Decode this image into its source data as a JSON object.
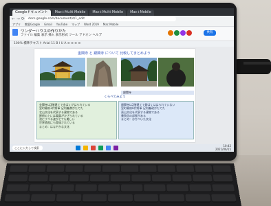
{
  "browser": {
    "tabs": [
      {
        "label": "Googleドキュメント",
        "active": true
      },
      {
        "label": "Mac+Multi-Mobile"
      },
      {
        "label": "Mac+Multi-Mobile"
      },
      {
        "label": "Mac+Mobile"
      }
    ],
    "url": "docs.google.com/document/d/1_edit",
    "bookmarks": [
      "アプリ",
      "教室Google",
      "Gmail",
      "YouTube",
      "マップ",
      "Word 2019",
      "Mac Mobile"
    ]
  },
  "document": {
    "title": "ワンダーハウスの作りかた",
    "menus": "ファイル 編集 表示 挿入 表示形式 ツール アドオン ヘルプ",
    "share_label": "共有",
    "toolbar_text": "100%  標準テキスト  Arial  11  B I U A  ≡ ≡ ≡ ≡",
    "heading": "金閣寺 と 銀閣寺 について 比較してまとめよう",
    "caption_right": "銀閣寺",
    "mid_label": "くらべてみよう",
    "green_box_lines": [
      "金閣寺は3階建てで金ぱくがはられている",
      "室町幕府3代将軍 足利義満がたてた",
      "北山文化を代表する建物である",
      "屋根の上には鳳凰がかざられている",
      "池にうつる姿がとても美しい",
      "世界遺産にも登録されている",
      "まとめ：はなやかな文化"
    ],
    "blue_box_lines": [
      "銀閣寺は2階建てで銀ぱくははられていない",
      "室町幕府8代将軍 足利義政がたてた",
      "東山文化を代表する建物である",
      "書院造の部屋がある",
      "まとめ：おちついた文化"
    ]
  },
  "taskbar": {
    "search_placeholder": "ここに入力して検索",
    "time": "10:42",
    "date": "2021/06/15"
  },
  "colors": {
    "browser_chrome": "#2e3135",
    "share_button": "#1a73e8",
    "green_box": "#e1f0dd",
    "blue_box": "#dce8f8",
    "heading_text": "#3a5bbf"
  }
}
